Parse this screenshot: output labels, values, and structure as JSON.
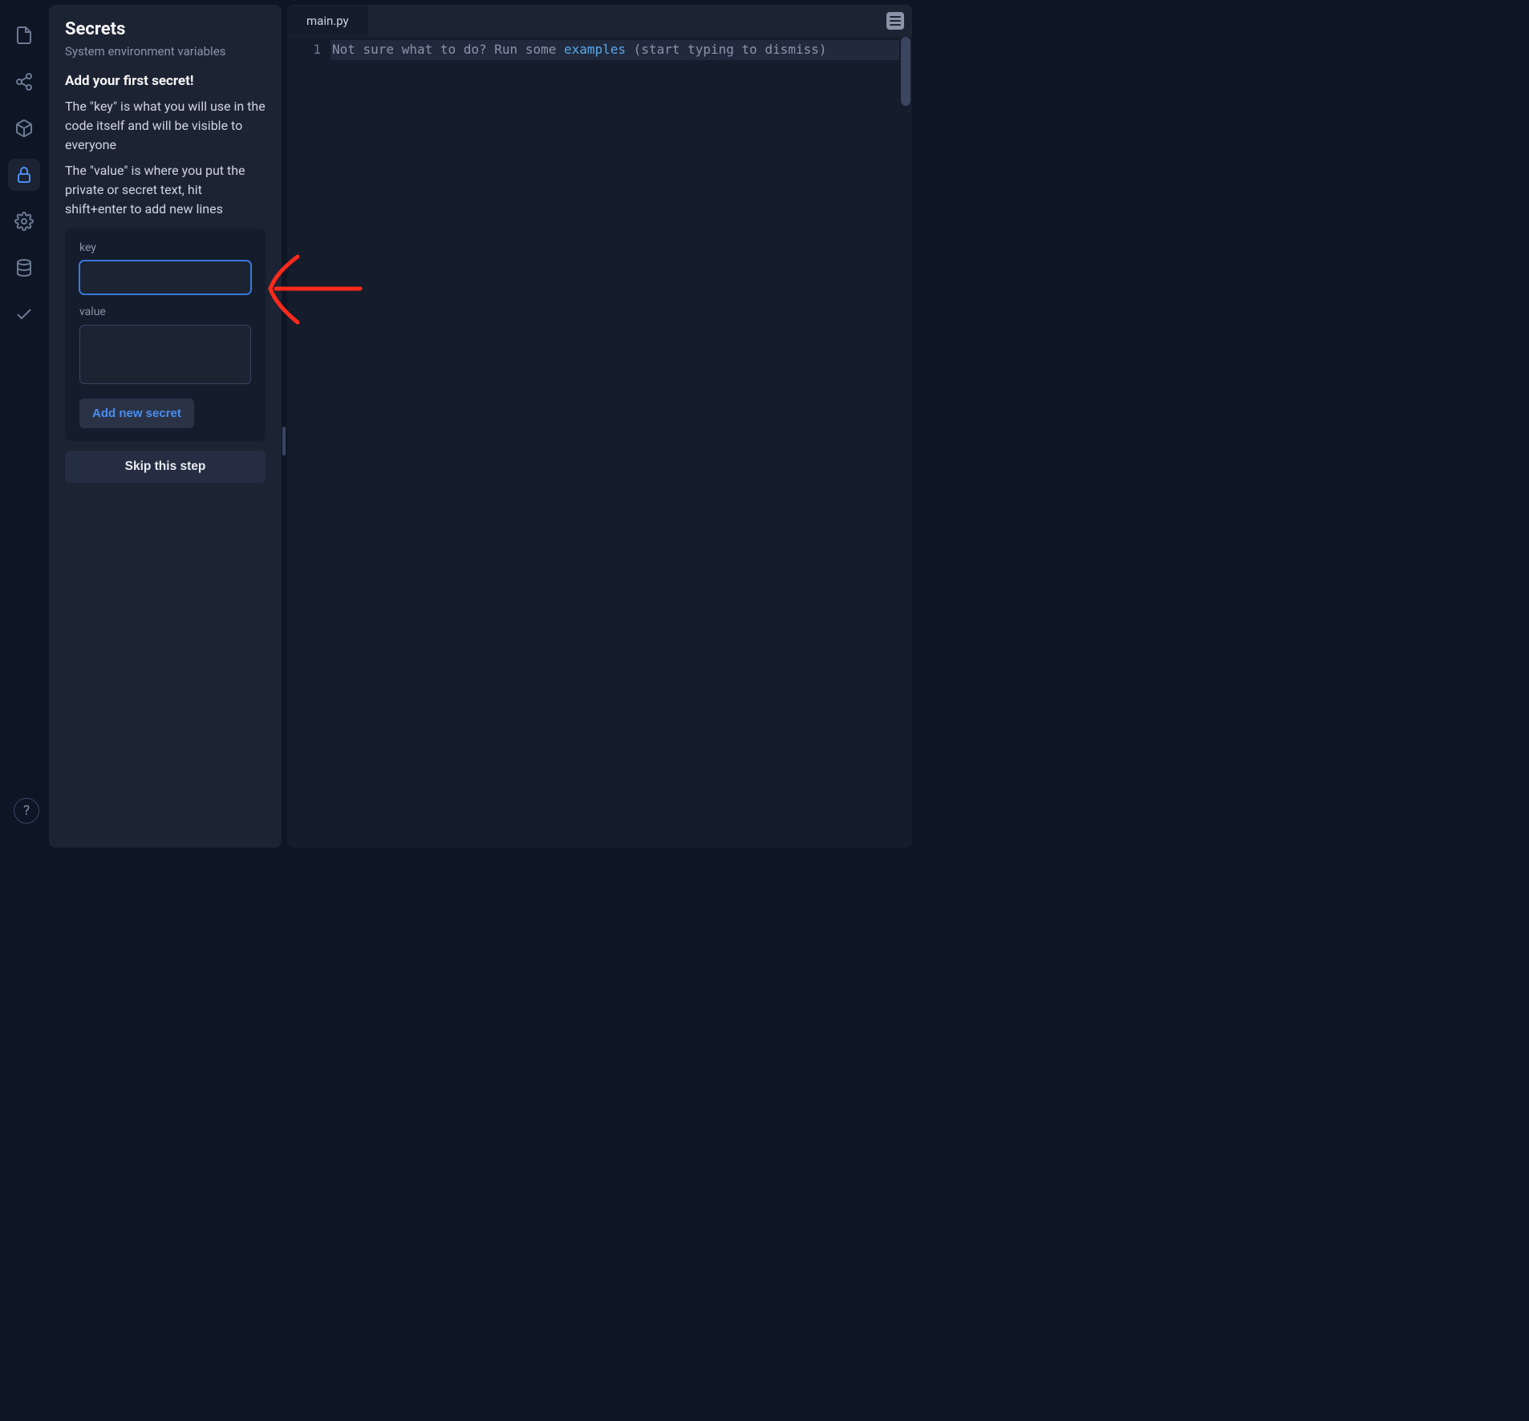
{
  "panel": {
    "title": "Secrets",
    "subtitle": "System environment variables",
    "heading": "Add your first secret!",
    "desc_key": "The \"key\" is what you will use in the code itself and will be visible to everyone",
    "desc_value": "The \"value\" is where you put the private or secret text, hit shift+enter to add new lines",
    "form": {
      "key_label": "key",
      "key_value": "",
      "value_label": "value",
      "value_value": "",
      "add_button": "Add new secret"
    },
    "skip_button": "Skip this step"
  },
  "editor": {
    "tab": "main.py",
    "line_number": "1",
    "code_prefix": "Not sure what to do? Run some ",
    "code_link": "examples",
    "code_suffix": " (start typing to dismiss)"
  },
  "help": "?"
}
